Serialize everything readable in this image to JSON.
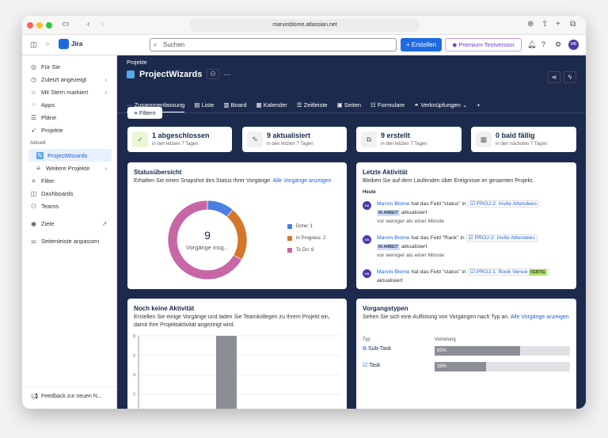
{
  "browser": {
    "url": "marvinblome.atlassian.net"
  },
  "header": {
    "app_name": "Jira",
    "search_placeholder": "Suchen",
    "create_label": "Erstellen",
    "premium_label": "Premium-Testversion",
    "avatar": "MB"
  },
  "sidebar": {
    "items": [
      {
        "label": "Für Sie",
        "icon": "user-circle-icon"
      },
      {
        "label": "Zuletzt angezeigt",
        "icon": "clock-icon"
      },
      {
        "label": "Mit Stern markiert",
        "icon": "star-icon"
      },
      {
        "label": "Apps",
        "icon": "apps-icon"
      },
      {
        "label": "Pläne",
        "icon": "plans-icon"
      },
      {
        "label": "Projekte",
        "icon": "rocket-icon"
      }
    ],
    "current_label": "Aktuell",
    "current_project": "ProjectWizards",
    "more_projects": "Weitere Projekte",
    "items2": [
      {
        "label": "Filter"
      },
      {
        "label": "Dashboards"
      },
      {
        "label": "Teams"
      }
    ],
    "goals": "Ziele",
    "customize": "Seitenleiste anpassen",
    "feedback": "Feedback zur neuen N..."
  },
  "project": {
    "breadcrumb": "Projekte",
    "title": "ProjectWizards",
    "tabs": [
      "Zusammenfassung",
      "Liste",
      "Board",
      "Kalender",
      "Zeitleiste",
      "Seiten",
      "Formulare",
      "Verknüpfungen"
    ],
    "filter_label": "Filtern"
  },
  "stats": [
    {
      "title": "1 abgeschlossen",
      "sub": "in den letzten 7 Tagen"
    },
    {
      "title": "9 aktualisiert",
      "sub": "in den letzten 7 Tagen"
    },
    {
      "title": "9 erstellt",
      "sub": "in den letzten 7 Tagen"
    },
    {
      "title": "0 bald fällig",
      "sub": "in den nächsten 7 Tagen"
    }
  ],
  "status": {
    "title": "Statusübersicht",
    "desc": "Erhalten Sie einen Snapshot des Status Ihrer Vorgänge.",
    "link": "Alle Vorgänge anzeigen",
    "total": "9",
    "total_label": "Vorgänge insg...",
    "chart_data": {
      "type": "pie",
      "donut": true,
      "categories": [
        "Done",
        "In Progress",
        "To Do"
      ],
      "values": [
        1,
        2,
        6
      ],
      "colors": [
        "#4a7fe0",
        "#d4772b",
        "#c966a5"
      ],
      "legend": [
        "Done: 1",
        "In Progress: 2",
        "To Do: 6"
      ],
      "legend_position": "right"
    }
  },
  "activity": {
    "title": "Letzte Aktivität",
    "desc": "Bleiben Sie auf dem Laufenden über Ereignisse im gesamten Projekt.",
    "day": "Heute",
    "items": [
      {
        "user": "Marvin Blome",
        "text": "hat das Feld \"status\" in",
        "issue": "PROJ-2: Invite Attendees",
        "badge": "IN ARBEIT",
        "after": "aktualisiert",
        "time": "vor weniger als einer Minute"
      },
      {
        "user": "Marvin Blome",
        "text": "hat das Feld \"Rank\" in",
        "issue": "PROJ-2: Invite Attendees",
        "badge": "IN ARBEIT",
        "after": "aktualisiert",
        "time": "vor weniger als einer Minute"
      },
      {
        "user": "Marvin Blome",
        "text": "hat das Feld \"status\" in",
        "issue": "PROJ-1: Book Venue",
        "badge": "FERTIG",
        "after": "aktualisiert"
      }
    ]
  },
  "noactivity": {
    "title": "Noch keine Aktivität",
    "desc": "Erstellen Sie einige Vorgänge und laden Sie Teamkollegen zu Ihrem Projekt ein, damit Ihre Projektaktivität angezeigt wird.",
    "chart_data": {
      "type": "bar",
      "values": [
        0,
        0,
        8,
        0,
        0
      ],
      "ylim": [
        0,
        8
      ],
      "yticks": [
        "0",
        "2",
        "4",
        "6",
        "8"
      ],
      "grid": true,
      "color": "#8b8e94"
    }
  },
  "types": {
    "title": "Vorgangstypen",
    "desc": "Sehen Sie sich eine Auflistung von Vorgängen nach Typ an.",
    "link": "Alle Vorgänge anzeigen",
    "col_type": "Typ",
    "col_dist": "Verteilung",
    "rows": [
      {
        "name": "Sub-Task",
        "pct": "63%",
        "value": 63
      },
      {
        "name": "Task",
        "pct": "38%",
        "value": 38
      }
    ]
  }
}
